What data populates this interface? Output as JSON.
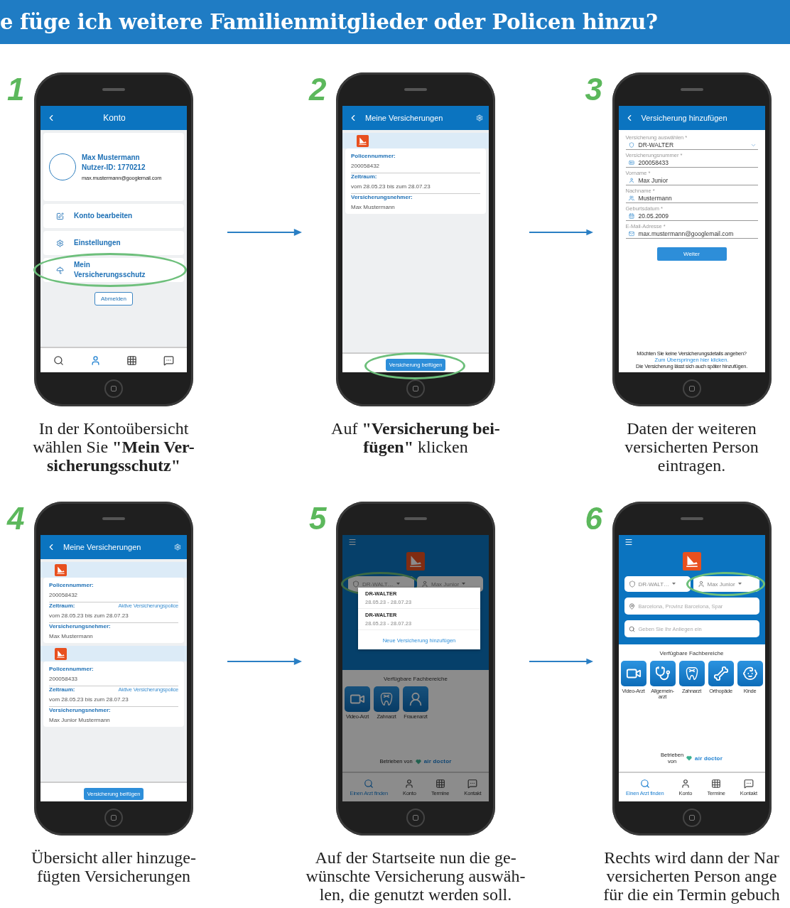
{
  "header": {
    "title": "e füge ich weitere Familienmitglieder oder Policen hinzu?"
  },
  "steps": [
    {
      "number": "1",
      "caption": [
        "In der Kontoübersicht",
        "wählen Sie **\"Mein Ver-**",
        "**sicherungsschutz\"**"
      ],
      "screen": {
        "kind": "account",
        "title": "Konto",
        "profile": {
          "name": "Max Mustermann",
          "user_id": "Nutzer-ID: 1770212",
          "email": "max.mustermann@googlemail.com"
        },
        "menu": [
          {
            "label": "Konto bearbeiten",
            "circled": false
          },
          {
            "label": "Einstellungen",
            "circled": false
          },
          {
            "label": "Mein\nVersicherungsschutz",
            "circled": true
          }
        ],
        "logout": "Abmelden",
        "tabs": [
          {
            "selected": false
          },
          {
            "selected": true
          },
          {
            "selected": false
          },
          {
            "selected": false
          }
        ]
      }
    },
    {
      "number": "2",
      "caption": [
        "Auf **\"Versicherung bei-**",
        "**fügen\"** klicken"
      ],
      "screen": {
        "kind": "policies",
        "title": "Meine Versicherungen",
        "policies": [
          {
            "fields": [
              {
                "label": "Policennummer:",
                "value": "200058432"
              },
              {
                "label": "Zeitraum:",
                "value": "vom 28.05.23 bis zum 28.07.23"
              },
              {
                "label": "Versicherungsnehmer:",
                "value": "Max Mustermann"
              }
            ]
          }
        ],
        "button": {
          "label": "Versicherung beifügen",
          "circled": true
        }
      }
    },
    {
      "number": "3",
      "caption": [
        "Daten der weiteren",
        "versicherten Person",
        "eintragen."
      ],
      "screen": {
        "kind": "form",
        "title": "Versicherung hinzufügen",
        "fields": [
          {
            "kind": "select",
            "label": "Versicherung auswählen *",
            "value": "DR-WALTER"
          },
          {
            "kind": "text",
            "label": "Versicherungsnummer *",
            "value": "200058433"
          },
          {
            "kind": "text",
            "label": "Vorname *",
            "value": "Max Junior"
          },
          {
            "kind": "text",
            "label": "Nachname *",
            "value": "Mustermann"
          },
          {
            "kind": "text",
            "label": "Geburtsdatum *",
            "value": "20.05.2009"
          },
          {
            "kind": "text",
            "label": "E-Mail-Adresse *",
            "value": "max.mustermann@googlemail.com"
          }
        ],
        "button": "Weiter",
        "footer": {
          "question": "Möchten Sie keine Versicherungsdetails angeben?",
          "link": "Zum Überspringen hier klicken.",
          "note": "Die Versicherung lässt sich auch später hinzufügen."
        }
      }
    },
    {
      "number": "4",
      "caption": [
        "Übersicht aller hinzuge-",
        "fügten Versicherungen"
      ],
      "screen": {
        "kind": "policies",
        "title": "Meine Versicherungen",
        "policies": [
          {
            "fields": [
              {
                "label": "Policennummer:",
                "value": "200058432"
              },
              {
                "label": "Zeitraum:",
                "value": "vom 28.05.23 bis zum 28.07.23",
                "status": "Aktive Versicherungspolice"
              },
              {
                "label": "Versicherungsnehmer:",
                "value": "Max Mustermann"
              }
            ]
          },
          {
            "fields": [
              {
                "label": "Policennummer:",
                "value": "200058433"
              },
              {
                "label": "Zeitraum:",
                "value": "vom 28.05.23 bis zum 28.07.23",
                "status": "Aktive Versicherungspolice"
              },
              {
                "label": "Versicherungsnehmer:",
                "value": "Max Junior Mustermann"
              }
            ]
          }
        ],
        "button": {
          "label": "Versicherung beifügen",
          "circled": false
        }
      }
    },
    {
      "number": "5",
      "caption": [
        "Auf der Startseite nun die ge-",
        "wünschte Versicherung auswäh-",
        "len, die genutzt werden soll."
      ],
      "screen": {
        "kind": "home",
        "dimmed": true,
        "selectors": [
          {
            "label": "DR-WALT…",
            "circled": true
          },
          {
            "label": "Max Junior",
            "circled": false
          }
        ],
        "dropdown": {
          "items": [
            {
              "name": "DR-WALTER",
              "dates": "28.05.23 - 28.07.23"
            },
            {
              "name": "DR-WALTER",
              "dates": "28.05.23 - 28.07.23"
            }
          ],
          "action": "Neue Versicherung hinzufügen"
        },
        "section_title": "Verfügbare Fachbereiche",
        "specialties": [
          {
            "kind": "video",
            "label": "Video-Arzt"
          },
          {
            "kind": "dentist",
            "label": "Zahnarzt"
          },
          {
            "kind": "gynecology",
            "label": "Frauenarzt"
          }
        ],
        "powered_by": "Betrieben von",
        "brand": "air doctor",
        "tabs": [
          {
            "label": "Einen Arzt finden",
            "selected": true
          },
          {
            "label": "Konto",
            "selected": false
          },
          {
            "label": "Termine",
            "selected": false
          },
          {
            "label": "Kontakt",
            "selected": false
          }
        ]
      }
    },
    {
      "number": "6",
      "caption": [
        "Rechts wird dann der Nar",
        "versicherten Person ange",
        "für die ein Termin gebuch"
      ],
      "screen": {
        "kind": "home",
        "dimmed": false,
        "selectors": [
          {
            "label": "DR-WALT…",
            "circled": false
          },
          {
            "label": "Max Junior",
            "circled": true
          }
        ],
        "searches": [
          {
            "placeholder": "Barcelona, Provinz Barcelona, Spar"
          },
          {
            "placeholder": "Geben Sie Ihr Anliegen ein"
          }
        ],
        "section_title": "Verfügbare Fachbereiche",
        "specialties": [
          {
            "kind": "video",
            "label": "Video-Arzt"
          },
          {
            "kind": "general",
            "label": "Allgemein-\narzt"
          },
          {
            "kind": "dentist",
            "label": "Zahnarzt"
          },
          {
            "kind": "orthopedics",
            "label": "Orthopäde"
          },
          {
            "kind": "pediatrics",
            "label": "Kinde"
          }
        ],
        "powered_by": "Betrieben\nvon",
        "brand": "air doctor",
        "tabs": [
          {
            "label": "Einen Arzt finden",
            "selected": true
          },
          {
            "label": "Konto",
            "selected": false
          },
          {
            "label": "Termine",
            "selected": false
          },
          {
            "label": "Kontakt",
            "selected": false
          }
        ]
      }
    }
  ]
}
